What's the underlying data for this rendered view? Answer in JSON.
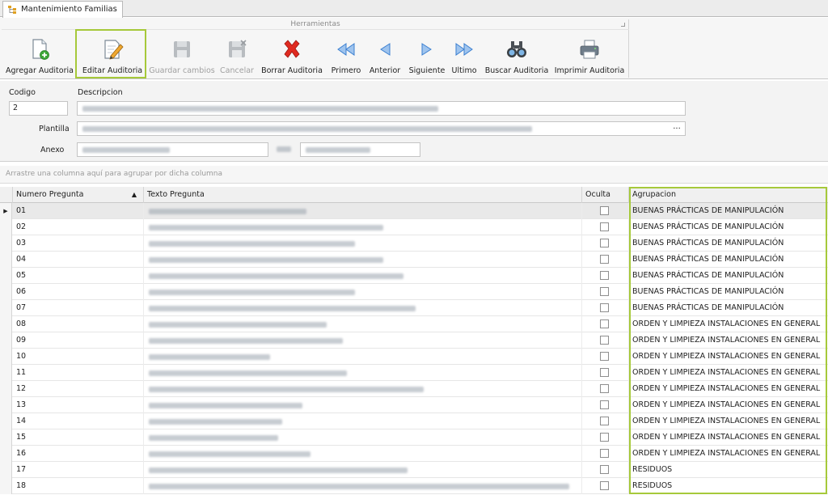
{
  "tab": {
    "label": "Mantenimiento Familias",
    "icon": "hierarchy-icon"
  },
  "ribbon": {
    "group_label": "Herramientas",
    "buttons": [
      {
        "label": "Agregar Auditoria",
        "icon": "add-document-icon",
        "enabled": true
      },
      {
        "label": "Editar Auditoria",
        "icon": "edit-pencil-icon",
        "enabled": true,
        "highlighted": true
      },
      {
        "label": "Guardar cambios",
        "icon": "save-disk-icon",
        "enabled": false
      },
      {
        "label": "Cancelar",
        "icon": "cancel-disk-icon",
        "enabled": false
      },
      {
        "label": "Borrar Auditoria",
        "icon": "delete-x-icon",
        "enabled": true
      },
      {
        "label": "Primero",
        "icon": "first-arrow-icon",
        "enabled": true
      },
      {
        "label": "Anterior",
        "icon": "previous-arrow-icon",
        "enabled": true
      },
      {
        "label": "Siguiente",
        "icon": "next-arrow-icon",
        "enabled": true
      },
      {
        "label": "Ultimo",
        "icon": "last-arrow-icon",
        "enabled": true
      },
      {
        "label": "Buscar Auditoria",
        "icon": "binoculars-icon",
        "enabled": true
      },
      {
        "label": "Imprimir Auditoria",
        "icon": "printer-icon",
        "enabled": true
      }
    ]
  },
  "form": {
    "codigo_label": "Codigo",
    "codigo_value": "2",
    "descripcion_label": "Descripcion",
    "plantilla_label": "Plantilla",
    "plantilla_button": "...",
    "anexo_label": "Anexo"
  },
  "grid": {
    "group_panel_hint": "Arrastre una columna aquí para agrupar por dicha columna",
    "columns": {
      "numero": "Numero Pregunta",
      "texto": "Texto Pregunta",
      "oculta": "Oculta",
      "agrupacion": "Agrupacion"
    },
    "rows": [
      {
        "numero": "01",
        "agrupacion": "BUENAS PRÁCTICAS DE MANIPULACIÓN"
      },
      {
        "numero": "02",
        "agrupacion": "BUENAS PRÁCTICAS DE MANIPULACIÓN"
      },
      {
        "numero": "03",
        "agrupacion": "BUENAS PRÁCTICAS DE MANIPULACIÓN"
      },
      {
        "numero": "04",
        "agrupacion": "BUENAS PRÁCTICAS DE MANIPULACIÓN"
      },
      {
        "numero": "05",
        "agrupacion": "BUENAS PRÁCTICAS DE MANIPULACIÓN"
      },
      {
        "numero": "06",
        "agrupacion": "BUENAS PRÁCTICAS DE MANIPULACIÓN"
      },
      {
        "numero": "07",
        "agrupacion": "BUENAS PRÁCTICAS DE MANIPULACIÓN"
      },
      {
        "numero": "08",
        "agrupacion": "ORDEN Y LIMPIEZA INSTALACIONES EN GENERAL"
      },
      {
        "numero": "09",
        "agrupacion": "ORDEN Y LIMPIEZA INSTALACIONES EN GENERAL"
      },
      {
        "numero": "10",
        "agrupacion": "ORDEN Y LIMPIEZA INSTALACIONES EN GENERAL"
      },
      {
        "numero": "11",
        "agrupacion": "ORDEN Y LIMPIEZA INSTALACIONES EN GENERAL"
      },
      {
        "numero": "12",
        "agrupacion": "ORDEN Y LIMPIEZA INSTALACIONES EN GENERAL"
      },
      {
        "numero": "13",
        "agrupacion": "ORDEN Y LIMPIEZA INSTALACIONES EN GENERAL"
      },
      {
        "numero": "14",
        "agrupacion": "ORDEN Y LIMPIEZA INSTALACIONES EN GENERAL"
      },
      {
        "numero": "15",
        "agrupacion": "ORDEN Y LIMPIEZA INSTALACIONES EN GENERAL"
      },
      {
        "numero": "16",
        "agrupacion": "ORDEN Y LIMPIEZA INSTALACIONES EN GENERAL"
      },
      {
        "numero": "17",
        "agrupacion": "RESIDUOS"
      },
      {
        "numero": "18",
        "agrupacion": "RESIDUOS"
      }
    ]
  }
}
